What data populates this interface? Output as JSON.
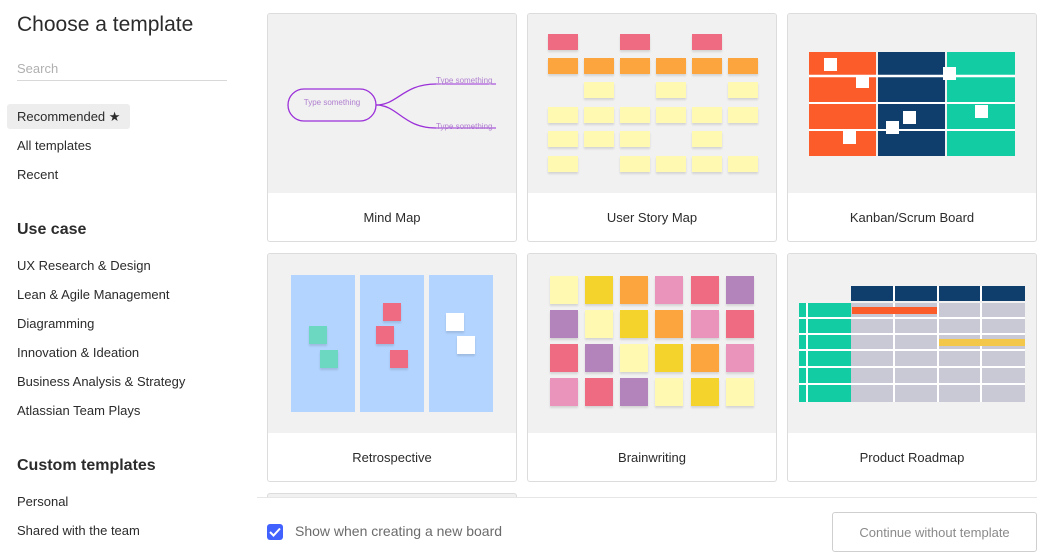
{
  "sidebar": {
    "title": "Choose a template",
    "search_placeholder": "Search",
    "nav": [
      {
        "label": "Recommended ★",
        "active": true
      },
      {
        "label": "All templates",
        "active": false
      },
      {
        "label": "Recent",
        "active": false
      }
    ],
    "use_case": {
      "heading": "Use case",
      "items": [
        "UX Research & Design",
        "Lean & Agile Management",
        "Diagramming",
        "Innovation & Ideation",
        "Business Analysis & Strategy",
        "Atlassian Team Plays"
      ]
    },
    "custom": {
      "heading": "Custom templates",
      "items": [
        "Personal",
        "Shared with the team"
      ]
    }
  },
  "templates": [
    {
      "name": "Mind Map",
      "preview": "mind-map"
    },
    {
      "name": "User Story Map",
      "preview": "user-story-map"
    },
    {
      "name": "Kanban/Scrum Board",
      "preview": "kanban"
    },
    {
      "name": "Retrospective",
      "preview": "retrospective"
    },
    {
      "name": "Brainwriting",
      "preview": "brainwriting"
    },
    {
      "name": "Product Roadmap",
      "preview": "product-roadmap"
    }
  ],
  "mind_map": {
    "center": "Type something",
    "branch_top": "Type something",
    "branch_bottom": "Type something"
  },
  "footer": {
    "checkbox_label": "Show when creating a new board",
    "checkbox_checked": true,
    "continue_label": "Continue without template"
  },
  "colors": {
    "accent": "#4262ff",
    "mind_map_purple": "#9b30d9",
    "kanban_orange": "#fc5b2a",
    "kanban_navy": "#103e6c",
    "kanban_teal": "#12cda4",
    "retro_blue": "#b3d4ff",
    "sticky_pink": "#ef6b82",
    "sticky_orange": "#fca43d",
    "sticky_yellow": "#fff9b1",
    "sticky_gold": "#f3d32c",
    "sticky_purple": "#b384bb",
    "sticky_rose": "#ea94bb",
    "sticky_teal": "#6cd8c1",
    "roadmap_gray": "#c9c9d6"
  }
}
